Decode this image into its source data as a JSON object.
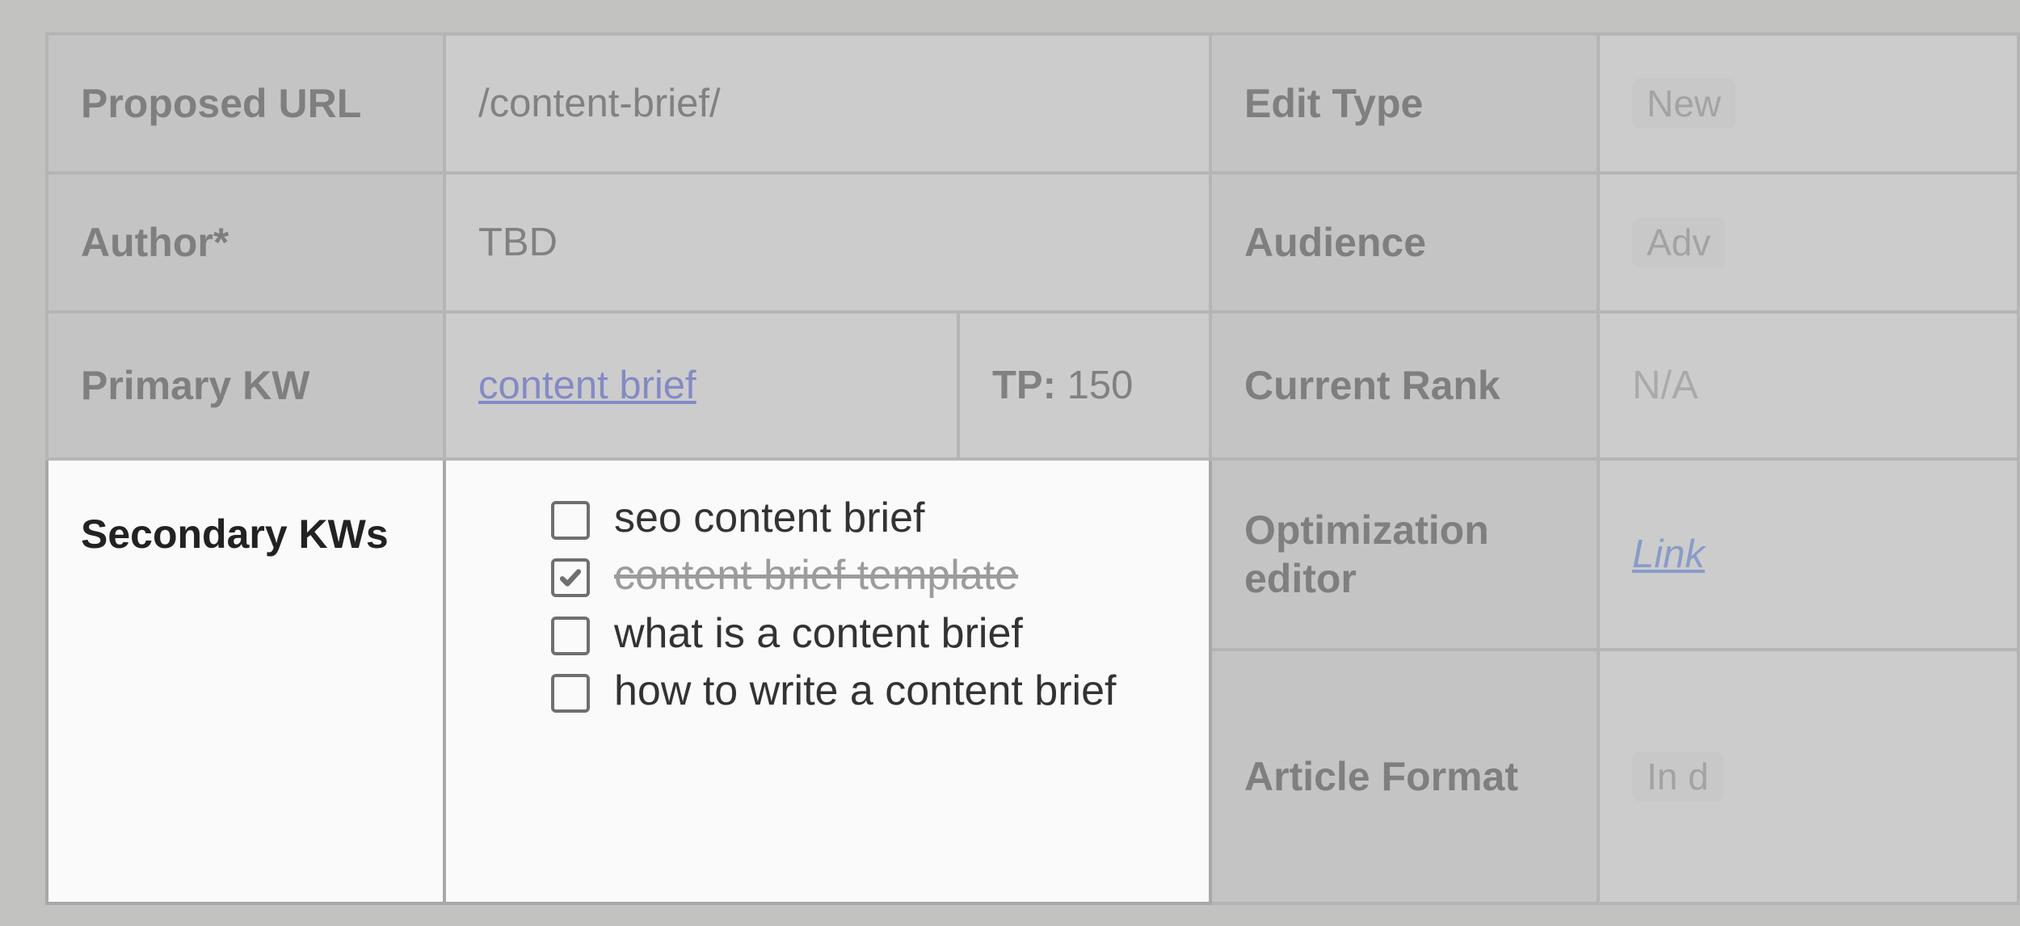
{
  "rows": {
    "proposed_url": {
      "label": "Proposed URL",
      "value": "/content-brief/"
    },
    "edit_type": {
      "label": "Edit Type",
      "value": "New"
    },
    "author": {
      "label": "Author*",
      "value": "TBD"
    },
    "audience": {
      "label": "Audience",
      "value": "Adv"
    },
    "primary_kw": {
      "label": "Primary KW",
      "value": "content brief"
    },
    "tp": {
      "label": "TP:",
      "value": "150"
    },
    "current_rank": {
      "label": "Current Rank",
      "value": "N/A"
    },
    "secondary_kws": {
      "label": "Secondary KWs"
    },
    "opt_editor": {
      "label": "Optimization editor",
      "value": "Link"
    },
    "article_fmt": {
      "label": "Article Format",
      "value": "In d"
    }
  },
  "secondary_kw_items": [
    {
      "text": "seo content brief",
      "checked": false
    },
    {
      "text": "content brief template",
      "checked": true
    },
    {
      "text": "what is a content brief",
      "checked": false
    },
    {
      "text": "how to write a content brief",
      "checked": false
    }
  ]
}
